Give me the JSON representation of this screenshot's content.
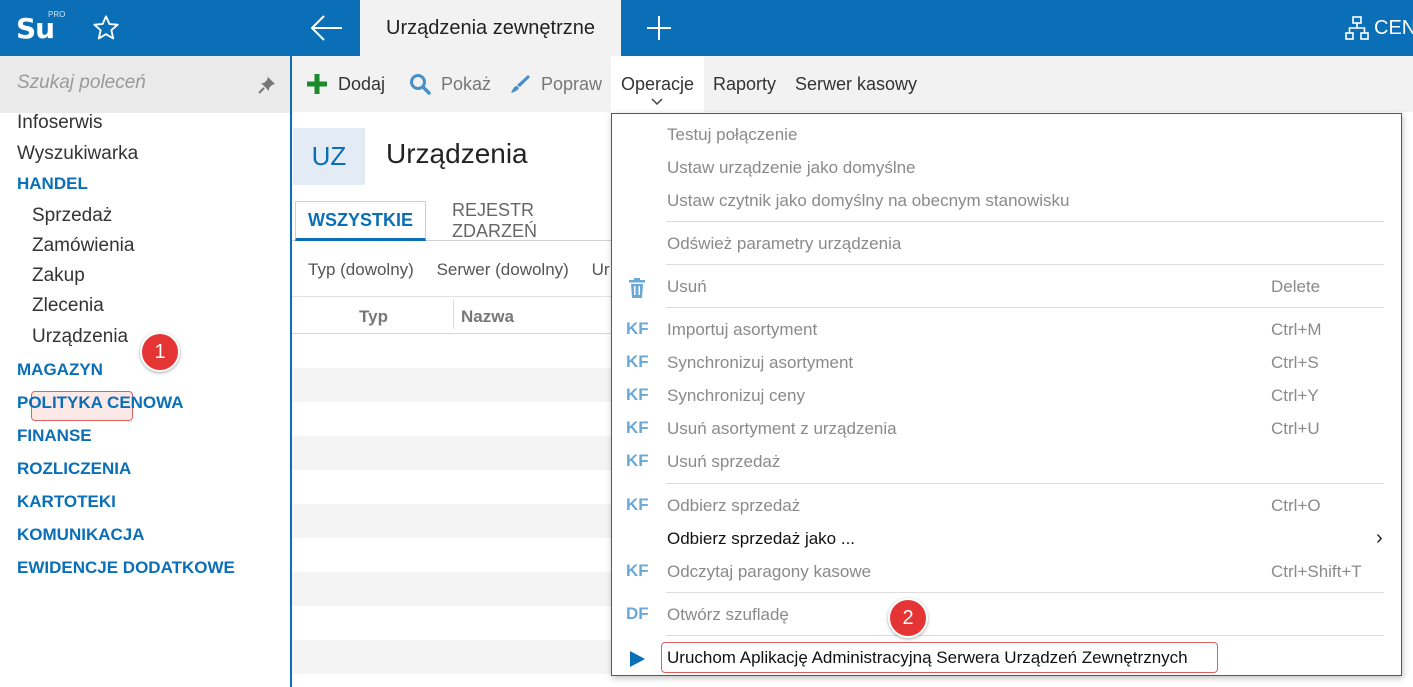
{
  "app": {
    "logo_text": "Su",
    "logo_superscript": "PRO",
    "active_tab": "Urządzenia zewnętrzne",
    "right_label": "CEN"
  },
  "sidebar": {
    "search_placeholder": "Szukaj poleceń",
    "items": [
      {
        "label": "Infoserwis",
        "kind": "item"
      },
      {
        "label": "Wyszukiwarka",
        "kind": "item"
      },
      {
        "label": "HANDEL",
        "kind": "section"
      },
      {
        "label": "Sprzedaż",
        "kind": "sub"
      },
      {
        "label": "Zamówienia",
        "kind": "sub"
      },
      {
        "label": "Zakup",
        "kind": "sub"
      },
      {
        "label": "Zlecenia",
        "kind": "sub"
      },
      {
        "label": "Urządzenia",
        "kind": "sub",
        "selected": true
      },
      {
        "label": "MAGAZYN",
        "kind": "section"
      },
      {
        "label": "POLITYKA CENOWA",
        "kind": "section"
      },
      {
        "label": "FINANSE",
        "kind": "section"
      },
      {
        "label": "ROZLICZENIA",
        "kind": "section"
      },
      {
        "label": "KARTOTEKI",
        "kind": "section"
      },
      {
        "label": "KOMUNIKACJA",
        "kind": "section"
      },
      {
        "label": "EWIDENCJE DODATKOWE",
        "kind": "section"
      }
    ]
  },
  "badges": {
    "one": "1",
    "two": "2"
  },
  "toolbar": {
    "add": "Dodaj",
    "show": "Pokaż",
    "edit": "Popraw",
    "operations": "Operacje",
    "reports": "Raporty",
    "cash_server": "Serwer kasowy"
  },
  "page": {
    "code": "UZ",
    "title": "Urządzenia",
    "tab_all": "WSZYSTKIE",
    "tab_events": "REJESTR ZDARZEŃ",
    "filter_type": "Typ (dowolny)",
    "filter_server": "Serwer (dowolny)",
    "filter_more": "Ur",
    "col_type": "Typ",
    "col_name": "Nazwa"
  },
  "menu": {
    "items": [
      {
        "label": "Testuj połączenie",
        "shortcut": ""
      },
      {
        "label": "Ustaw urządzenie jako domyślne",
        "shortcut": ""
      },
      {
        "label": "Ustaw czytnik jako domyślny na obecnym stanowisku",
        "shortcut": ""
      },
      {
        "label": "Odśwież parametry urządzenia",
        "shortcut": ""
      },
      {
        "label": "Usuń",
        "shortcut": "Delete",
        "icon": "trash-icon"
      },
      {
        "label": "Importuj asortyment",
        "shortcut": "Ctrl+M",
        "tag": "KF"
      },
      {
        "label": "Synchronizuj asortyment",
        "shortcut": "Ctrl+S",
        "tag": "KF"
      },
      {
        "label": "Synchronizuj ceny",
        "shortcut": "Ctrl+Y",
        "tag": "KF"
      },
      {
        "label": "Usuń asortyment z urządzenia",
        "shortcut": "Ctrl+U",
        "tag": "KF"
      },
      {
        "label": "Usuń sprzedaż",
        "shortcut": "",
        "tag": "KF"
      },
      {
        "label": "Odbierz sprzedaż",
        "shortcut": "Ctrl+O",
        "tag": "KF"
      },
      {
        "label": "Odbierz sprzedaż jako ...",
        "shortcut": "",
        "submenu": "›"
      },
      {
        "label": "Odczytaj paragony kasowe",
        "shortcut": "Ctrl+Shift+T",
        "tag": "KF"
      },
      {
        "label": "Otwórz szufladę",
        "shortcut": "",
        "tag": "DF"
      },
      {
        "label": "Uruchom Aplikację Administracyjną Serwera Urządzeń Zewnętrznych",
        "shortcut": "",
        "icon": "play-icon"
      }
    ]
  },
  "colors": {
    "brand": "#0a6fb7",
    "badge": "#e53434",
    "tag": "#6aa9d6"
  }
}
